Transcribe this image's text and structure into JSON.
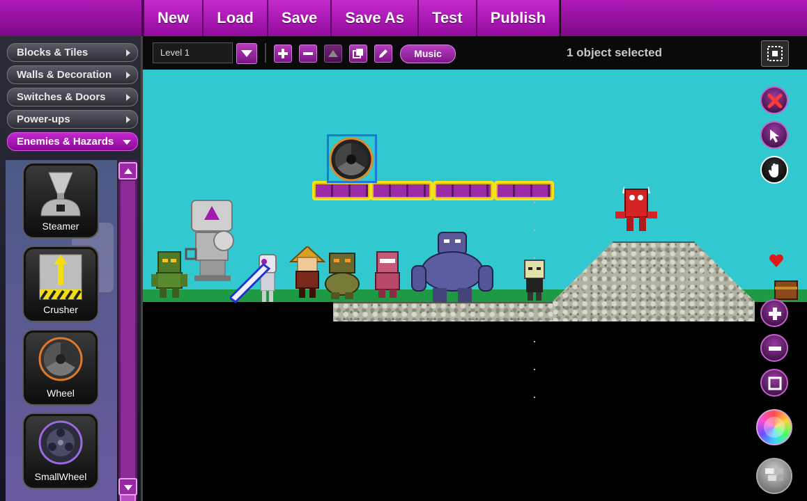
{
  "menu": {
    "items": [
      "New",
      "Load",
      "Save",
      "Save As",
      "Test",
      "Publish"
    ]
  },
  "sidebar": {
    "categories": [
      {
        "label": "Blocks & Tiles",
        "active": false
      },
      {
        "label": "Walls & Decoration",
        "active": false
      },
      {
        "label": "Switches & Doors",
        "active": false
      },
      {
        "label": "Power-ups",
        "active": false
      },
      {
        "label": "Enemies & Hazards",
        "active": true
      }
    ],
    "palette": [
      {
        "label": "Steamer",
        "icon": "steamer-icon"
      },
      {
        "label": "Crusher",
        "icon": "crusher-icon"
      },
      {
        "label": "Wheel",
        "icon": "wheel-icon"
      },
      {
        "label": "SmallWheel",
        "icon": "small-wheel-icon"
      }
    ]
  },
  "toolbar": {
    "level": "Level 1",
    "music_label": "Music",
    "status": "1 object selected"
  },
  "colors": {
    "accent": "#a21aad",
    "sky": "#31c9cf",
    "grass": "#1f9a44",
    "platform_edge": "#f4e21b",
    "selection": "#1a7bd9"
  }
}
